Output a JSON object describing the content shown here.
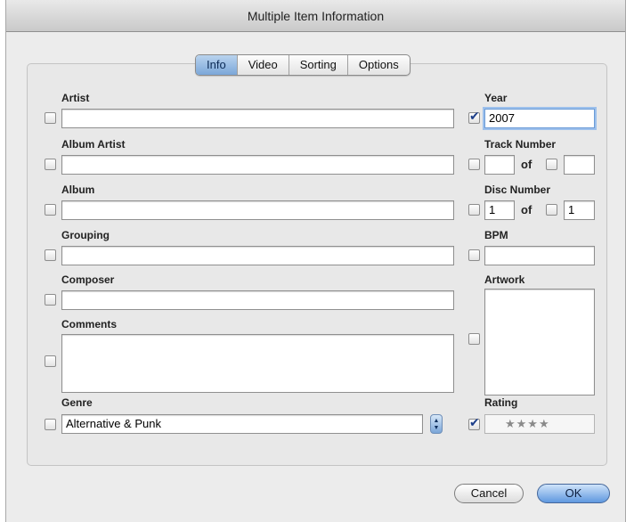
{
  "window": {
    "title": "Multiple Item Information"
  },
  "tabs": [
    "Info",
    "Video",
    "Sorting",
    "Options"
  ],
  "active_tab": "Info",
  "fields": {
    "artist": {
      "label": "Artist",
      "value": ""
    },
    "album_artist": {
      "label": "Album Artist",
      "value": ""
    },
    "album": {
      "label": "Album",
      "value": ""
    },
    "grouping": {
      "label": "Grouping",
      "value": ""
    },
    "composer": {
      "label": "Composer",
      "value": ""
    },
    "comments": {
      "label": "Comments",
      "value": ""
    },
    "genre": {
      "label": "Genre",
      "value": "Alternative & Punk"
    },
    "year": {
      "label": "Year",
      "value": "2007",
      "checked": true
    },
    "track_number": {
      "label": "Track Number",
      "value": "",
      "of_label": "of",
      "total": ""
    },
    "disc_number": {
      "label": "Disc Number",
      "value": "1",
      "of_label": "of",
      "total": "1"
    },
    "bpm": {
      "label": "BPM",
      "value": ""
    },
    "artwork": {
      "label": "Artwork"
    },
    "rating": {
      "label": "Rating",
      "stars": 4,
      "display": "★★★★",
      "checked": true
    }
  },
  "buttons": {
    "cancel": "Cancel",
    "ok": "OK"
  },
  "icons": {
    "stepper": "up-down-arrows-icon",
    "check": "checkmark-icon"
  },
  "colors": {
    "accent": "#7ba7d9",
    "default_button": "#5f98df"
  }
}
